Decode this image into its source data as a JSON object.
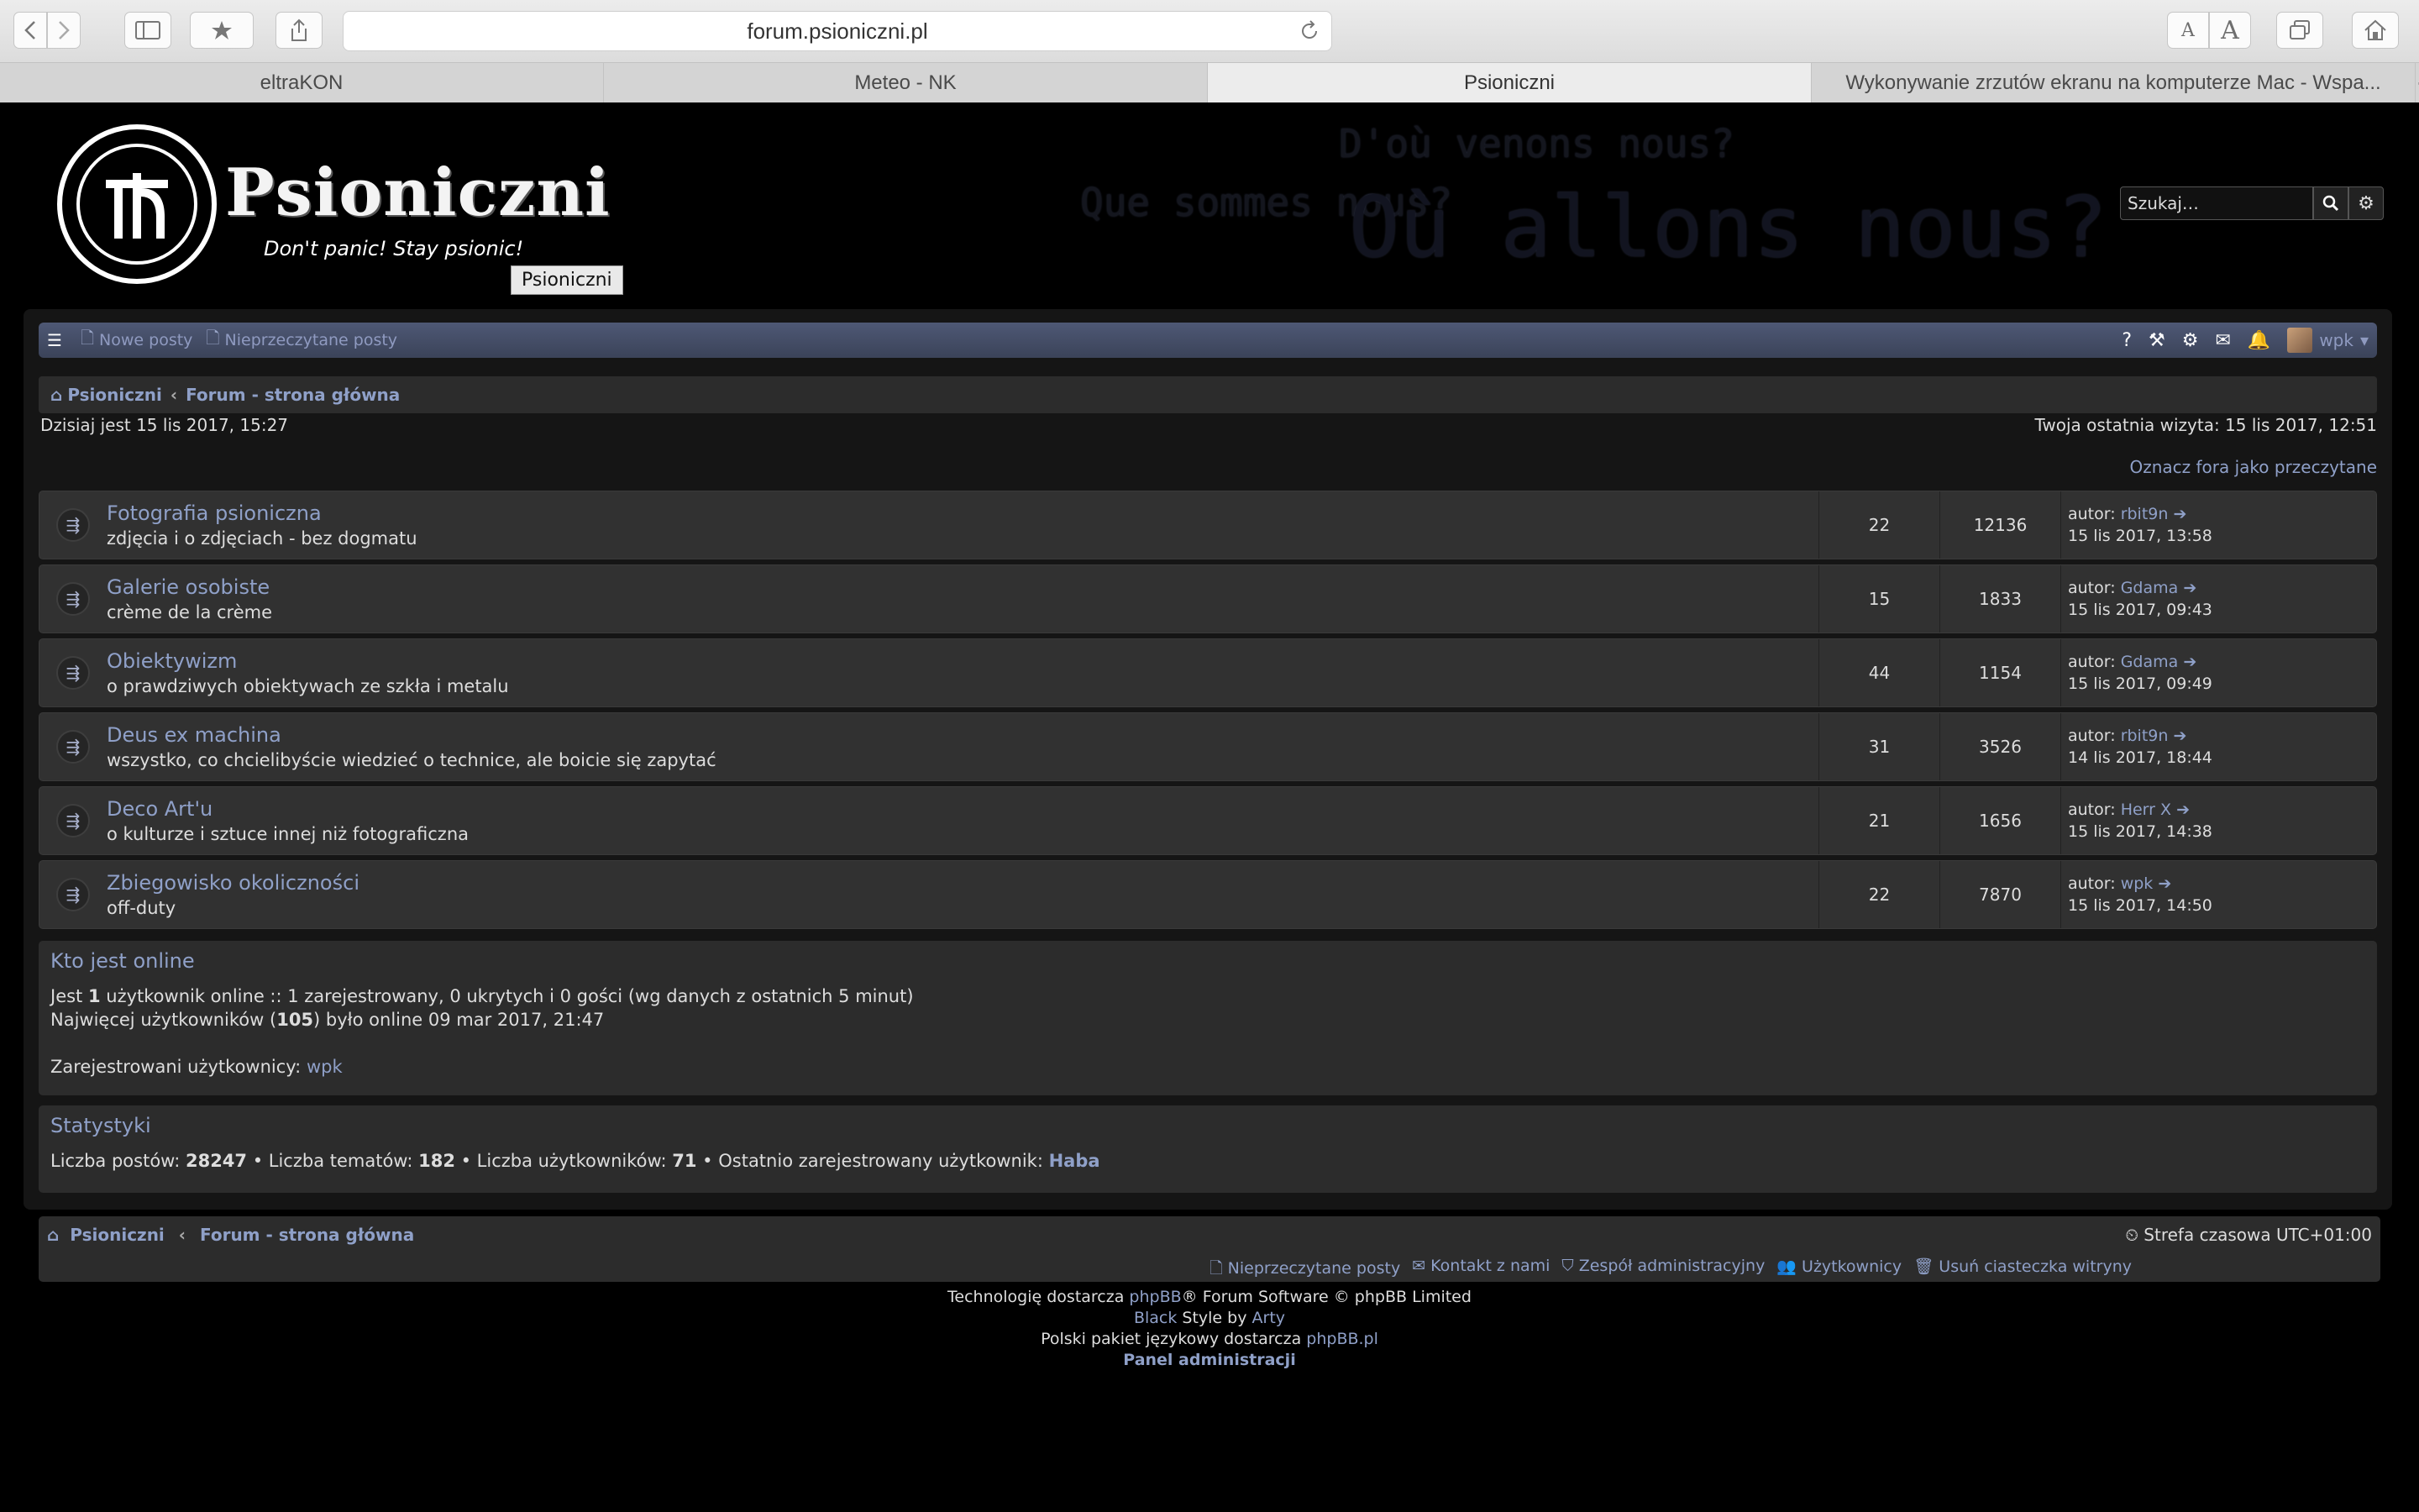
{
  "browser": {
    "url": "forum.psioniczni.pl",
    "tabs": [
      "eltraKON",
      "Meteo - NK",
      "Psioniczni",
      "Wykonywanie zrzutów ekranu na komputerze Mac - Wspa..."
    ],
    "active_tab": 2,
    "font_small": "A",
    "font_large": "A"
  },
  "header": {
    "site_name": "Psioniczni",
    "site_desc": "Don't panic! Stay psionic!",
    "tooltip": "Psioniczni",
    "ghost_text": [
      "D'où venons nous?",
      "Que sommes nous?",
      "Où allons nous?"
    ],
    "search_placeholder": "Szukaj…"
  },
  "navbar": {
    "new_posts": "Nowe posty",
    "unread_posts": "Nieprzeczytane posty",
    "username": "wpk"
  },
  "breadcrumb": {
    "home": "Psioniczni",
    "index": "Forum - strona główna"
  },
  "date_line": "Dzisiaj jest 15 lis 2017, 15:27",
  "last_visit": "Twoja ostatnia wizyta: 15 lis 2017, 12:51",
  "mark_read": "Oznacz fora jako przeczytane",
  "forums": [
    {
      "title": "Fotografia psioniczna",
      "desc": "zdjęcia i o zdjęciach - bez dogmatu",
      "topics": "22",
      "posts": "12136",
      "author_label": "autor:",
      "author": "rbit9n",
      "date": "15 lis 2017, 13:58"
    },
    {
      "title": "Galerie osobiste",
      "desc": "crème de la crème",
      "topics": "15",
      "posts": "1833",
      "author_label": "autor:",
      "author": "Gdama",
      "date": "15 lis 2017, 09:43"
    },
    {
      "title": "Obiektywizm",
      "desc": "o prawdziwych obiektywach ze szkła i metalu",
      "topics": "44",
      "posts": "1154",
      "author_label": "autor:",
      "author": "Gdama",
      "date": "15 lis 2017, 09:49"
    },
    {
      "title": "Deus ex machina",
      "desc": "wszystko, co chcielibyście wiedzieć o technice, ale boicie się zapytać",
      "topics": "31",
      "posts": "3526",
      "author_label": "autor:",
      "author": "rbit9n",
      "date": "14 lis 2017, 18:44"
    },
    {
      "title": "Deco Art'u",
      "desc": "o kulturze i sztuce innej niż fotograficzna",
      "topics": "21",
      "posts": "1656",
      "author_label": "autor:",
      "author": "Herr X",
      "date": "15 lis 2017, 14:38"
    },
    {
      "title": "Zbiegowisko okoliczności",
      "desc": "off-duty",
      "topics": "22",
      "posts": "7870",
      "author_label": "autor:",
      "author": "wpk",
      "date": "15 lis 2017, 14:50"
    }
  ],
  "online": {
    "title": "Kto jest online",
    "line1_a": "Jest ",
    "line1_count": "1",
    "line1_b": " użytkownik online :: 1 zarejestrowany, 0 ukrytych i 0 gości (wg danych z ostatnich 5 minut)",
    "line2_a": "Najwięcej użytkowników (",
    "line2_count": "105",
    "line2_b": ") było online 09 mar 2017, 21:47",
    "registered_label": "Zarejestrowani użytkownicy: ",
    "registered_user": "wpk"
  },
  "stats": {
    "title": "Statystyki",
    "posts_label": "Liczba postów: ",
    "posts": "28247",
    "topics_label": " • Liczba tematów: ",
    "topics": "182",
    "users_label": " • Liczba użytkowników: ",
    "users": "71",
    "newest_label": " • Ostatnio zarejestrowany użytkownik: ",
    "newest": "Haba"
  },
  "footer": {
    "home": "Psioniczni",
    "index": "Forum - strona główna",
    "timezone": "Strefa czasowa UTC+01:00",
    "links": [
      "Nieprzeczytane posty",
      "Kontakt z nami",
      "Zespół administracyjny",
      "Użytkownicy",
      "Usuń ciasteczka witryny"
    ]
  },
  "credits": {
    "l1_a": "Technologię dostarcza ",
    "l1_link": "phpBB",
    "l1_b": "® Forum Software © phpBB Limited",
    "l2_link1": "Black",
    "l2_mid": " Style by ",
    "l2_link2": "Arty",
    "l3_a": "Polski pakiet językowy dostarcza ",
    "l3_link": "phpBB.pl",
    "l4": "Panel administracji"
  }
}
